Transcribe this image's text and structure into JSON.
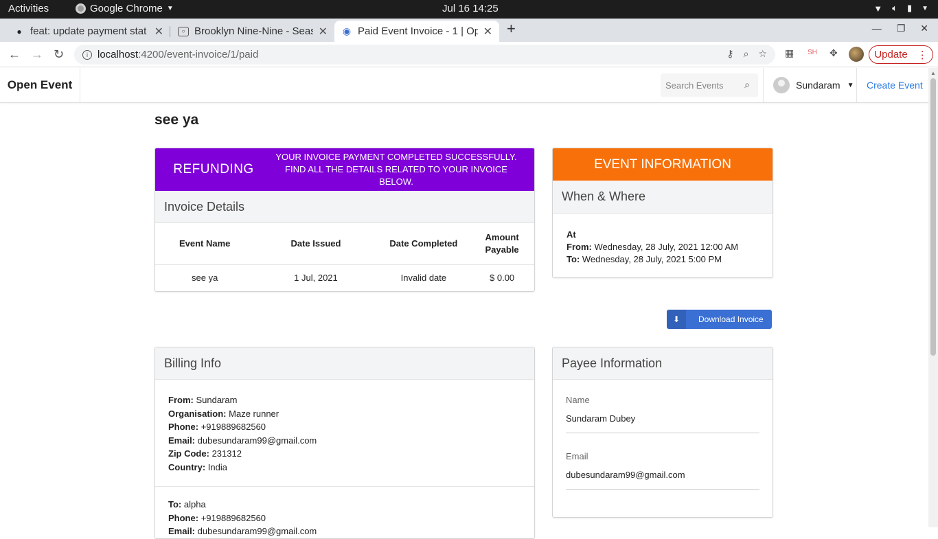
{
  "system_bar": {
    "activities": "Activities",
    "app_name": "Google Chrome",
    "clock": "Jul 16  14:25"
  },
  "browser": {
    "tabs": [
      {
        "title": "feat: update payment stat",
        "icon": "github-icon",
        "active": false
      },
      {
        "title": "Brooklyn Nine-Nine - Seas",
        "icon": "page-icon",
        "active": false
      },
      {
        "title": "Paid Event Invoice - 1 | Op",
        "icon": "open-event-icon",
        "active": true
      }
    ],
    "url_host": "localhost",
    "url_path": ":4200/event-invoice/1/paid",
    "update_label": "Update"
  },
  "site_nav": {
    "brand": "Open Event",
    "search_placeholder": "Search Events",
    "user_name": "Sundaram",
    "create_event": "Create Event"
  },
  "page": {
    "title": "see ya"
  },
  "status": {
    "label": "REFUNDING",
    "message_line1": "YOUR INVOICE PAYMENT COMPLETED SUCCESSFULLY.",
    "message_line2": "FIND ALL THE DETAILS RELATED TO YOUR INVOICE BELOW.",
    "color": "#7f00d8"
  },
  "invoice_details": {
    "heading": "Invoice Details",
    "columns": [
      "Event Name",
      "Date Issued",
      "Date Completed",
      "Amount Payable"
    ],
    "rows": [
      [
        "see ya",
        "1 Jul, 2021",
        "Invalid date",
        "$ 0.00"
      ]
    ]
  },
  "event_info": {
    "banner": "EVENT INFORMATION",
    "banner_color": "#f7700a",
    "subheading": "When & Where",
    "at_label": "At",
    "from_label": "From:",
    "from_value": "Wednesday, 28 July, 2021 12:00 AM",
    "to_label": "To:",
    "to_value": "Wednesday, 28 July, 2021 5:00 PM"
  },
  "download_invoice": "Download Invoice",
  "billing_info": {
    "heading": "Billing Info",
    "from": [
      {
        "label": "From:",
        "value": "Sundaram"
      },
      {
        "label": "Organisation:",
        "value": "Maze runner"
      },
      {
        "label": "Phone:",
        "value": "+919889682560"
      },
      {
        "label": "Email:",
        "value": "dubesundaram99@gmail.com"
      },
      {
        "label": "Zip Code:",
        "value": "231312"
      },
      {
        "label": "Country:",
        "value": "India"
      }
    ],
    "to": [
      {
        "label": "To:",
        "value": "alpha"
      },
      {
        "label": "Phone:",
        "value": "+919889682560"
      },
      {
        "label": "Email:",
        "value": "dubesundaram99@gmail.com"
      }
    ]
  },
  "payee": {
    "heading": "Payee Information",
    "name_label": "Name",
    "name_value": "Sundaram Dubey",
    "email_label": "Email",
    "email_value": "dubesundaram99@gmail.com"
  }
}
